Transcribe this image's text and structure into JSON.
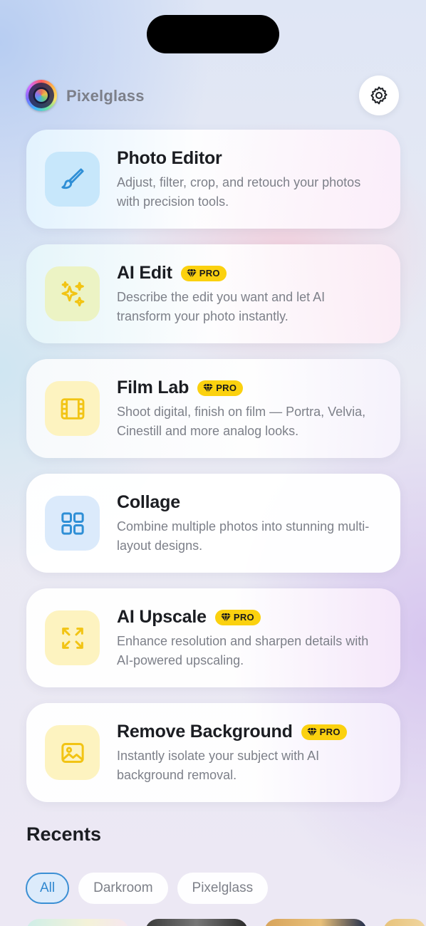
{
  "app": {
    "title": "Pixelglass"
  },
  "header": {
    "settings_icon": "gear-icon"
  },
  "badge_label": "PRO",
  "cards": [
    {
      "title": "Photo Editor",
      "description": "Adjust, filter, crop, and retouch your photos with precision tools.",
      "icon": "brush-icon",
      "pro": false,
      "tile_color": "#c7e7fb",
      "icon_color": "#2f8fd6"
    },
    {
      "title": "AI Edit",
      "description": "Describe the edit you want and let AI transform your photo instantly.",
      "icon": "sparkles-icon",
      "pro": true,
      "tile_color": "#ecf3c4",
      "icon_color": "#f2c414"
    },
    {
      "title": "Film Lab",
      "description": "Shoot digital, finish on film — Portra, Velvia, Cinestill and more analog looks.",
      "icon": "film-icon",
      "pro": true,
      "tile_color": "#fdf3c0",
      "icon_color": "#f2c414"
    },
    {
      "title": "Collage",
      "description": "Combine multiple photos into stunning multi-layout designs.",
      "icon": "grid-icon",
      "pro": false,
      "tile_color": "#dbeafb",
      "icon_color": "#2f8fd6"
    },
    {
      "title": "AI Upscale",
      "description": "Enhance resolution and sharpen details with AI-powered upscaling.",
      "icon": "expand-icon",
      "pro": true,
      "tile_color": "#fdf3c0",
      "icon_color": "#f2c414"
    },
    {
      "title": "Remove Background",
      "description": "Instantly isolate your subject with AI background removal.",
      "icon": "image-icon",
      "pro": true,
      "tile_color": "#fdf3c0",
      "icon_color": "#f2c414"
    }
  ],
  "recents": {
    "title": "Recents",
    "filters": [
      {
        "label": "All",
        "active": true
      },
      {
        "label": "Darkroom",
        "active": false
      },
      {
        "label": "Pixelglass",
        "active": false
      }
    ]
  },
  "colors": {
    "pro_badge": "#fbd10f",
    "accent_blue": "#3b8fd4",
    "title_text": "#1b1d22",
    "muted_text": "#7d8089"
  }
}
